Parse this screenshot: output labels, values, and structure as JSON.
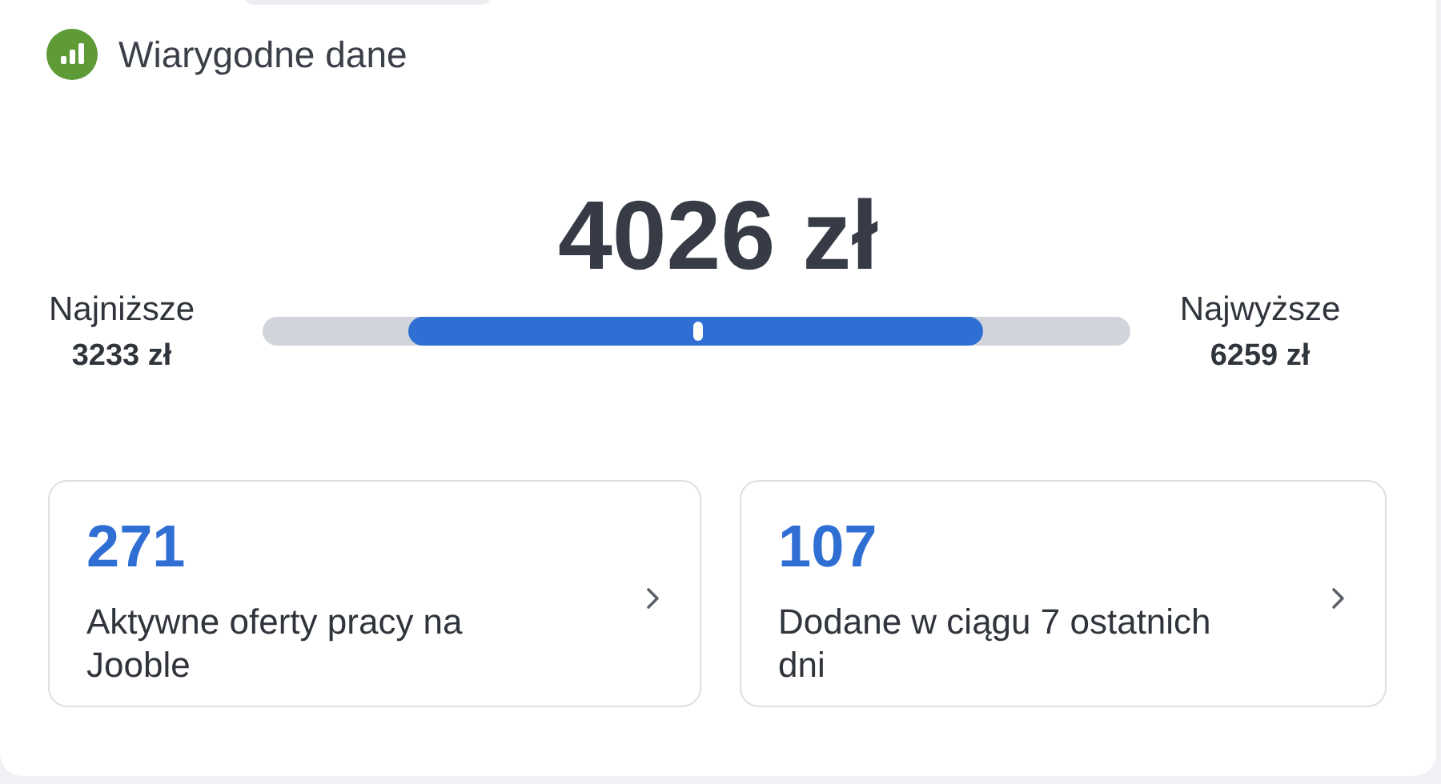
{
  "header": {
    "title": "Wiarygodne dane"
  },
  "salary": {
    "value": "4026 zł",
    "low_label": "Najniższe",
    "low_value": "3233 zł",
    "high_label": "Najwyższe",
    "high_value": "6259 zł",
    "marker": {
      "level": 0.501
    }
  },
  "stats": [
    {
      "count": "271",
      "label": "Aktywne oferty pracy na Jooble"
    },
    {
      "count": "107",
      "label": "Dodane w ciągu 7 ostatnich dni"
    }
  ]
}
